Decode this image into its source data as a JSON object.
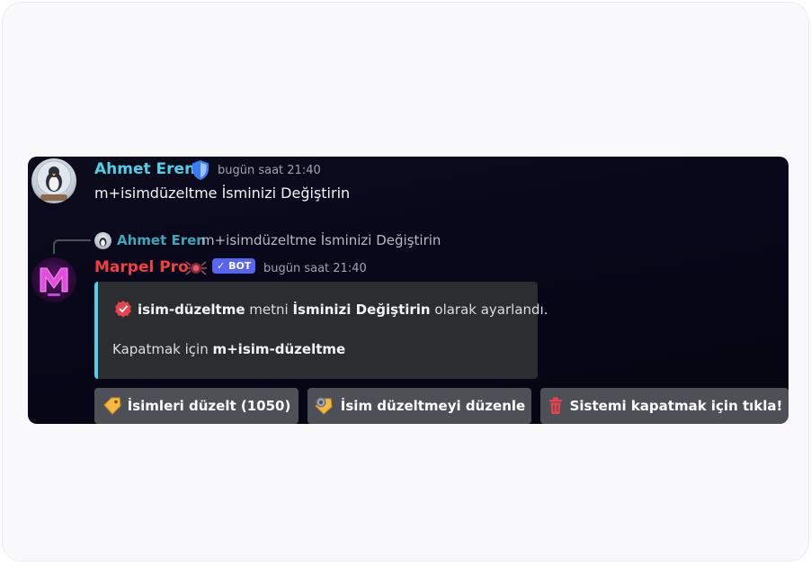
{
  "user_message": {
    "author": "Ahmet Eren",
    "timestamp": "bugün saat 21:40",
    "content": "m+isimdüzeltme İsminizi Değiştirin",
    "avatar_icon": "penguin-snowglobe-avatar",
    "badge_icon": "shield-badge-icon",
    "name_color": "#4fd0e6"
  },
  "reply_preview": {
    "author": "Ahmet Eren",
    "content": "m+isimdüzeltme İsminizi Değiştirin"
  },
  "bot_message": {
    "author": "Marpel Pro",
    "bot_tag": "BOT",
    "timestamp": "bugün saat 21:40",
    "name_color": "#f23f42",
    "avatar_icon": "marpel-logo-avatar",
    "embed": {
      "accent_color": "#4fd0e6",
      "line1": {
        "key": "isim-düzeltme",
        "mid": " metni ",
        "value": "İsminizi Değiştirin",
        "tail": " olarak ayarlandı."
      },
      "line2": {
        "prefix": "Kapatmak için ",
        "command": "m+isim-düzeltme"
      }
    },
    "buttons": [
      {
        "label": "İsimleri düzelt (1050)",
        "icon": "label-tag-icon"
      },
      {
        "label": "İsim düzeltmeyi düzenle",
        "icon": "tag-settings-icon"
      },
      {
        "label": "Sistemi kapatmak için tıkla!",
        "icon": "trash-icon"
      }
    ]
  }
}
